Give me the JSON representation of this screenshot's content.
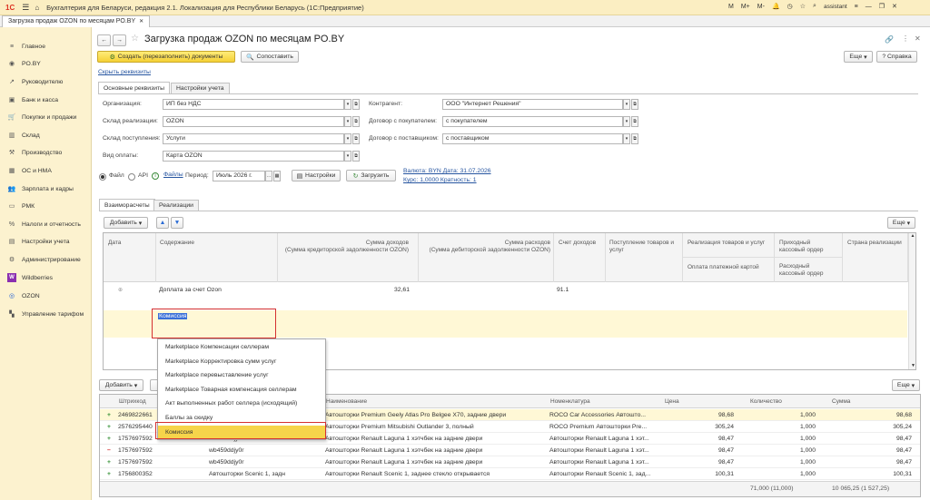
{
  "titlebar": {
    "logo": "1С",
    "title": "Бухгалтерия для Беларуси, редакция 2.1. Локализация для Республики Беларусь (1С:Предприятие)",
    "user": "assistant",
    "icons": [
      "bell-icon",
      "history-icon",
      "star-icon"
    ],
    "m_label": "M",
    "mplus_label": "M+",
    "mminus_label": "M-"
  },
  "doc_tab": {
    "label": "Загрузка продаж OZON по месяцам PO.BY"
  },
  "sidebar": {
    "items": [
      {
        "label": "Главное",
        "icon": "menu-icon"
      },
      {
        "label": "PO.BY",
        "icon": "circle-icon"
      },
      {
        "label": "Руководителю",
        "icon": "chart-icon"
      },
      {
        "label": "Банк и касса",
        "icon": "bank-icon"
      },
      {
        "label": "Покупки и продажи",
        "icon": "cart-icon"
      },
      {
        "label": "Склад",
        "icon": "warehouse-icon"
      },
      {
        "label": "Производство",
        "icon": "factory-icon"
      },
      {
        "label": "ОС и НМА",
        "icon": "assets-icon"
      },
      {
        "label": "Зарплата и кадры",
        "icon": "people-icon"
      },
      {
        "label": "РМК",
        "icon": "register-icon"
      },
      {
        "label": "Налоги и отчетность",
        "icon": "taxes-icon"
      },
      {
        "label": "Настройки учета",
        "icon": "settings-icon"
      },
      {
        "label": "Администрирование",
        "icon": "gear-icon"
      },
      {
        "label": "Wildberries",
        "icon": "wb-icon"
      },
      {
        "label": "OZON",
        "icon": "ozon-icon"
      },
      {
        "label": "Управление тарифом",
        "icon": "tariff-icon"
      }
    ]
  },
  "form": {
    "title": "Загрузка продаж OZON по месяцам PO.BY",
    "create_button": "Создать (перезаполнить) документы",
    "compare_button": "Сопоставить",
    "more_button": "Еще",
    "help_button": "Справка",
    "hide_link": "Скрыть реквизиты",
    "tabs": [
      "Основные реквизиты",
      "Настройки учета"
    ],
    "fields": {
      "org_label": "Организация:",
      "org_value": "ИП без НДС",
      "sklad_real_label": "Склад реализации:",
      "sklad_real_value": "OZON",
      "sklad_post_label": "Склад поступления:",
      "sklad_post_value": "Услуги",
      "vid_oplaty_label": "Вид оплаты:",
      "vid_oplaty_value": "Карта OZON",
      "kontragent_label": "Контрагент:",
      "kontragent_value": "ООО \"Интернет Решения\"",
      "dog_pok_label": "Договор с покупателем:",
      "dog_pok_value": "с покупателем",
      "dog_post_label": "Договор с поставщиком:",
      "dog_post_value": "с поставщиком"
    },
    "source": {
      "file_label": "Файл",
      "api_label": "API",
      "files_link": "Файлы",
      "period_label": "Период:",
      "period_value": "Июль 2026 г.",
      "settings_button": "Настройки",
      "load_button": "Загрузить",
      "currency_line": "Валюта: BYN Дата: 31.07.2026",
      "rate_line": "Курс: 1,0000 Кратность: 1"
    }
  },
  "upper_table": {
    "tabs": [
      "Взаиморасчеты",
      "Реализации"
    ],
    "add_button": "Добавить",
    "more_button": "Еще",
    "headers": {
      "date": "Дата",
      "content": "Содержание",
      "income_1": "Сумма доходов",
      "income_2": "(Сумма кредиторской задолженности OZON)",
      "expense_1": "Сумма расходов",
      "expense_2": "(Сумма дебиторской задолженности OZON)",
      "account": "Счет доходов",
      "receipt_1": "Поступление товаров и",
      "receipt_2": "услуг",
      "real_1": "Реализация товаров и услуг",
      "real_sub": "Оплата платежной картой",
      "pko_1": "Приходный",
      "pko_2": "кассовый ордер",
      "rko_1": "Расходный",
      "rko_2": "кассовый ордер",
      "country": "Страна реализации"
    },
    "rows": [
      {
        "content": "Доплата за счет Ozon",
        "income": "32,61",
        "account": "91.1"
      }
    ],
    "edit_value": "Комиссия"
  },
  "dropdown": {
    "items": [
      "Marketplace Компенсации селлерам",
      "Marketplace Корректировка сумм услуг",
      "Marketplace перевыставление услуг",
      "Marketplace Товарная компенсация селлерам",
      "Акт выполненных работ селлера (исходящий)",
      "Баллы за скидку",
      "Комиссия"
    ],
    "selected_index": 6
  },
  "lower_table": {
    "add_button": "Добавить",
    "more_button": "Еще",
    "headers": [
      "Штрихкод",
      "",
      "Наименование",
      "Номенклатура",
      "Цена",
      "Количество",
      "Сумма"
    ],
    "rows": [
      {
        "sign": "+",
        "barcode": "2469822661",
        "art": "",
        "name": "Автошторки Premium Geely Atlas Pro Belgee X70, задние двери",
        "nom": "ROCO Car Accessories Автошто...",
        "price": "98,68",
        "qty": "1,000",
        "sum": "98,68"
      },
      {
        "sign": "+",
        "barcode": "2576295440",
        "art": "",
        "name": "Автошторки Premium Mitsubishi Outlander 3, полный",
        "nom": "ROCO Premium Автошторки Pre...",
        "price": "305,24",
        "qty": "1,000",
        "sum": "305,24"
      },
      {
        "sign": "+",
        "barcode": "1757697592",
        "art": "wb459ddjy0r",
        "name": "Автошторки Renault Laguna 1 хэтчбек на задние двери",
        "nom": "Автошторки Renault Laguna 1 хэт...",
        "price": "98,47",
        "qty": "1,000",
        "sum": "98,47"
      },
      {
        "sign": "−",
        "barcode": "1757697592",
        "art": "wb459ddjy0r",
        "name": "Автошторки Renault Laguna 1 хэтчбек на задние двери",
        "nom": "Автошторки Renault Laguna 1 хэт...",
        "price": "98,47",
        "qty": "1,000",
        "sum": "98,47"
      },
      {
        "sign": "+",
        "barcode": "1757697592",
        "art": "wb459ddjy0r",
        "name": "Автошторки Renault Laguna 1 хэтчбек на задние двери",
        "nom": "Автошторки Renault Laguna 1 хэт...",
        "price": "98,47",
        "qty": "1,000",
        "sum": "98,47"
      },
      {
        "sign": "+",
        "barcode": "1756800352",
        "art": "Автошторки Scenic 1, задн",
        "name": "Автошторки Renault Scenic 1, заднее стекло открывается",
        "nom": "Автошторки Renault Scenic 1, зад...",
        "price": "100,31",
        "qty": "1,000",
        "sum": "100,31"
      }
    ],
    "footer": {
      "qty_total": "71,000 (11,000)",
      "sum_total": "10 065,25 (1 527,25)"
    }
  },
  "colors": {
    "accent_yellow": "#f5d035",
    "sidebar": "#fcf2cf",
    "highlight_row": "#fff8d6",
    "red_frame": "#d43030"
  }
}
